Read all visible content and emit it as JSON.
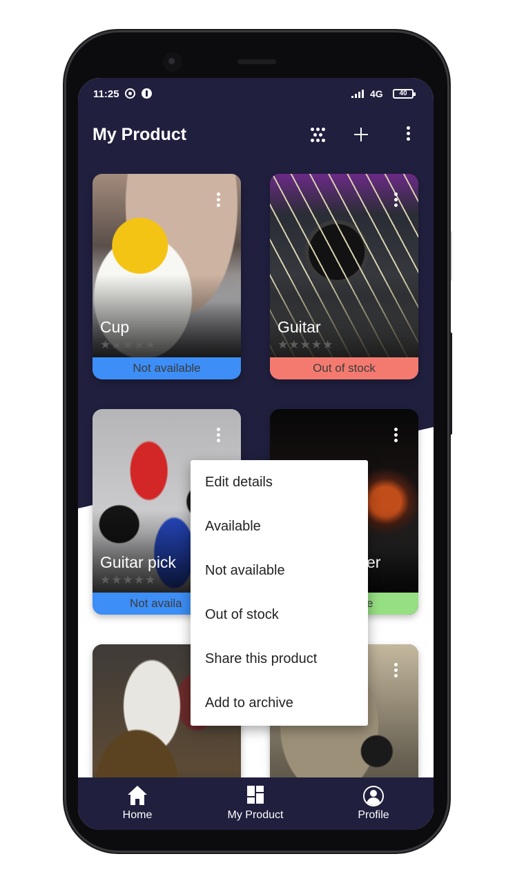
{
  "status_bar": {
    "time": "11:25",
    "network": "4G",
    "battery": "40"
  },
  "app_bar": {
    "title": "My Product"
  },
  "products": [
    {
      "name": "Cup",
      "rating": 0,
      "availability": "Not available",
      "status_color": "#3d8ef6"
    },
    {
      "name": "Guitar",
      "rating": 0,
      "availability": "Out of stock",
      "status_color": "#f47a6f"
    },
    {
      "name": "Guitar pick",
      "rating": 0,
      "availability": "Not availa",
      "status_color": "#3d8ef6"
    },
    {
      "name": "er",
      "rating": 0,
      "availability": "e",
      "status_color": "#97df83"
    },
    {
      "name": "",
      "availability": ""
    },
    {
      "name": "",
      "availability": ""
    }
  ],
  "context_menu": {
    "items": [
      "Edit details",
      "Available",
      "Not available",
      "Out of stock",
      "Share this product",
      "Add to archive"
    ]
  },
  "bottom_nav": {
    "items": [
      {
        "label": "Home",
        "icon": "home-icon"
      },
      {
        "label": "My Product",
        "icon": "grid-icon"
      },
      {
        "label": "Profile",
        "icon": "profile-icon"
      }
    ]
  },
  "colors": {
    "primary_dark": "#201f3e",
    "not_available": "#3d8ef6",
    "out_of_stock": "#f47a6f",
    "available": "#97df83"
  }
}
